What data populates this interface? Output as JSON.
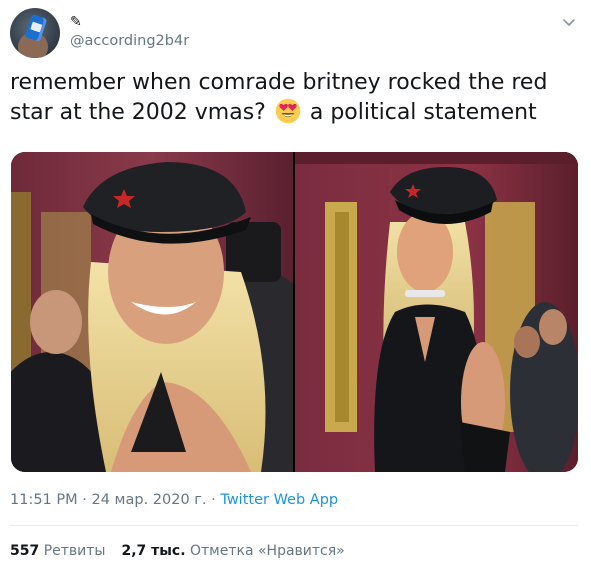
{
  "author": {
    "display_name": "✎",
    "handle": "@according2b4r"
  },
  "tweet": {
    "text_before_emoji": "remember when comrade britney rocked the red star at the 2002 vmas?",
    "emoji": "heart-eyes-emoji",
    "text_after_emoji": "a political statement"
  },
  "meta": {
    "time": "11:51 PM",
    "separator": "·",
    "date": "24 мар. 2020 г.",
    "app": "Twitter Web App"
  },
  "stats": {
    "retweets_count": "557",
    "retweets_label": "Ретвиты",
    "likes_count": "2,7 тыс.",
    "likes_label": "Отметка «Нравится»"
  },
  "colors": {
    "link": "#1b95e0",
    "secondary_text": "#657786",
    "primary_text": "#14171a"
  }
}
